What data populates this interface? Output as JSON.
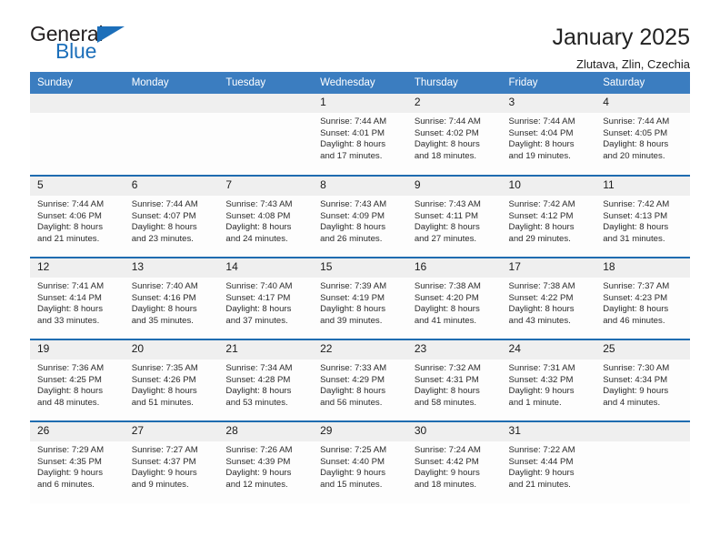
{
  "logo": {
    "text_top": "General",
    "text_bottom": "Blue",
    "flag_icon": "blue-triangle-flag-icon",
    "brand_color": "#1c6fba"
  },
  "header": {
    "title": "January 2025",
    "subtitle": "Zlutava, Zlin, Czechia"
  },
  "theme": {
    "header_row_bg": "#3b7dc0",
    "week_separator": "#1f6cb0",
    "daynum_bg": "#efefef"
  },
  "weekday_headers": [
    "Sunday",
    "Monday",
    "Tuesday",
    "Wednesday",
    "Thursday",
    "Friday",
    "Saturday"
  ],
  "weeks": [
    [
      {
        "day": "",
        "sunrise": "",
        "sunset": "",
        "daylight_line1": "",
        "daylight_line2": ""
      },
      {
        "day": "",
        "sunrise": "",
        "sunset": "",
        "daylight_line1": "",
        "daylight_line2": ""
      },
      {
        "day": "",
        "sunrise": "",
        "sunset": "",
        "daylight_line1": "",
        "daylight_line2": ""
      },
      {
        "day": "1",
        "sunrise": "Sunrise: 7:44 AM",
        "sunset": "Sunset: 4:01 PM",
        "daylight_line1": "Daylight: 8 hours",
        "daylight_line2": "and 17 minutes."
      },
      {
        "day": "2",
        "sunrise": "Sunrise: 7:44 AM",
        "sunset": "Sunset: 4:02 PM",
        "daylight_line1": "Daylight: 8 hours",
        "daylight_line2": "and 18 minutes."
      },
      {
        "day": "3",
        "sunrise": "Sunrise: 7:44 AM",
        "sunset": "Sunset: 4:04 PM",
        "daylight_line1": "Daylight: 8 hours",
        "daylight_line2": "and 19 minutes."
      },
      {
        "day": "4",
        "sunrise": "Sunrise: 7:44 AM",
        "sunset": "Sunset: 4:05 PM",
        "daylight_line1": "Daylight: 8 hours",
        "daylight_line2": "and 20 minutes."
      }
    ],
    [
      {
        "day": "5",
        "sunrise": "Sunrise: 7:44 AM",
        "sunset": "Sunset: 4:06 PM",
        "daylight_line1": "Daylight: 8 hours",
        "daylight_line2": "and 21 minutes."
      },
      {
        "day": "6",
        "sunrise": "Sunrise: 7:44 AM",
        "sunset": "Sunset: 4:07 PM",
        "daylight_line1": "Daylight: 8 hours",
        "daylight_line2": "and 23 minutes."
      },
      {
        "day": "7",
        "sunrise": "Sunrise: 7:43 AM",
        "sunset": "Sunset: 4:08 PM",
        "daylight_line1": "Daylight: 8 hours",
        "daylight_line2": "and 24 minutes."
      },
      {
        "day": "8",
        "sunrise": "Sunrise: 7:43 AM",
        "sunset": "Sunset: 4:09 PM",
        "daylight_line1": "Daylight: 8 hours",
        "daylight_line2": "and 26 minutes."
      },
      {
        "day": "9",
        "sunrise": "Sunrise: 7:43 AM",
        "sunset": "Sunset: 4:11 PM",
        "daylight_line1": "Daylight: 8 hours",
        "daylight_line2": "and 27 minutes."
      },
      {
        "day": "10",
        "sunrise": "Sunrise: 7:42 AM",
        "sunset": "Sunset: 4:12 PM",
        "daylight_line1": "Daylight: 8 hours",
        "daylight_line2": "and 29 minutes."
      },
      {
        "day": "11",
        "sunrise": "Sunrise: 7:42 AM",
        "sunset": "Sunset: 4:13 PM",
        "daylight_line1": "Daylight: 8 hours",
        "daylight_line2": "and 31 minutes."
      }
    ],
    [
      {
        "day": "12",
        "sunrise": "Sunrise: 7:41 AM",
        "sunset": "Sunset: 4:14 PM",
        "daylight_line1": "Daylight: 8 hours",
        "daylight_line2": "and 33 minutes."
      },
      {
        "day": "13",
        "sunrise": "Sunrise: 7:40 AM",
        "sunset": "Sunset: 4:16 PM",
        "daylight_line1": "Daylight: 8 hours",
        "daylight_line2": "and 35 minutes."
      },
      {
        "day": "14",
        "sunrise": "Sunrise: 7:40 AM",
        "sunset": "Sunset: 4:17 PM",
        "daylight_line1": "Daylight: 8 hours",
        "daylight_line2": "and 37 minutes."
      },
      {
        "day": "15",
        "sunrise": "Sunrise: 7:39 AM",
        "sunset": "Sunset: 4:19 PM",
        "daylight_line1": "Daylight: 8 hours",
        "daylight_line2": "and 39 minutes."
      },
      {
        "day": "16",
        "sunrise": "Sunrise: 7:38 AM",
        "sunset": "Sunset: 4:20 PM",
        "daylight_line1": "Daylight: 8 hours",
        "daylight_line2": "and 41 minutes."
      },
      {
        "day": "17",
        "sunrise": "Sunrise: 7:38 AM",
        "sunset": "Sunset: 4:22 PM",
        "daylight_line1": "Daylight: 8 hours",
        "daylight_line2": "and 43 minutes."
      },
      {
        "day": "18",
        "sunrise": "Sunrise: 7:37 AM",
        "sunset": "Sunset: 4:23 PM",
        "daylight_line1": "Daylight: 8 hours",
        "daylight_line2": "and 46 minutes."
      }
    ],
    [
      {
        "day": "19",
        "sunrise": "Sunrise: 7:36 AM",
        "sunset": "Sunset: 4:25 PM",
        "daylight_line1": "Daylight: 8 hours",
        "daylight_line2": "and 48 minutes."
      },
      {
        "day": "20",
        "sunrise": "Sunrise: 7:35 AM",
        "sunset": "Sunset: 4:26 PM",
        "daylight_line1": "Daylight: 8 hours",
        "daylight_line2": "and 51 minutes."
      },
      {
        "day": "21",
        "sunrise": "Sunrise: 7:34 AM",
        "sunset": "Sunset: 4:28 PM",
        "daylight_line1": "Daylight: 8 hours",
        "daylight_line2": "and 53 minutes."
      },
      {
        "day": "22",
        "sunrise": "Sunrise: 7:33 AM",
        "sunset": "Sunset: 4:29 PM",
        "daylight_line1": "Daylight: 8 hours",
        "daylight_line2": "and 56 minutes."
      },
      {
        "day": "23",
        "sunrise": "Sunrise: 7:32 AM",
        "sunset": "Sunset: 4:31 PM",
        "daylight_line1": "Daylight: 8 hours",
        "daylight_line2": "and 58 minutes."
      },
      {
        "day": "24",
        "sunrise": "Sunrise: 7:31 AM",
        "sunset": "Sunset: 4:32 PM",
        "daylight_line1": "Daylight: 9 hours",
        "daylight_line2": "and 1 minute."
      },
      {
        "day": "25",
        "sunrise": "Sunrise: 7:30 AM",
        "sunset": "Sunset: 4:34 PM",
        "daylight_line1": "Daylight: 9 hours",
        "daylight_line2": "and 4 minutes."
      }
    ],
    [
      {
        "day": "26",
        "sunrise": "Sunrise: 7:29 AM",
        "sunset": "Sunset: 4:35 PM",
        "daylight_line1": "Daylight: 9 hours",
        "daylight_line2": "and 6 minutes."
      },
      {
        "day": "27",
        "sunrise": "Sunrise: 7:27 AM",
        "sunset": "Sunset: 4:37 PM",
        "daylight_line1": "Daylight: 9 hours",
        "daylight_line2": "and 9 minutes."
      },
      {
        "day": "28",
        "sunrise": "Sunrise: 7:26 AM",
        "sunset": "Sunset: 4:39 PM",
        "daylight_line1": "Daylight: 9 hours",
        "daylight_line2": "and 12 minutes."
      },
      {
        "day": "29",
        "sunrise": "Sunrise: 7:25 AM",
        "sunset": "Sunset: 4:40 PM",
        "daylight_line1": "Daylight: 9 hours",
        "daylight_line2": "and 15 minutes."
      },
      {
        "day": "30",
        "sunrise": "Sunrise: 7:24 AM",
        "sunset": "Sunset: 4:42 PM",
        "daylight_line1": "Daylight: 9 hours",
        "daylight_line2": "and 18 minutes."
      },
      {
        "day": "31",
        "sunrise": "Sunrise: 7:22 AM",
        "sunset": "Sunset: 4:44 PM",
        "daylight_line1": "Daylight: 9 hours",
        "daylight_line2": "and 21 minutes."
      },
      {
        "day": "",
        "sunrise": "",
        "sunset": "",
        "daylight_line1": "",
        "daylight_line2": ""
      }
    ]
  ]
}
